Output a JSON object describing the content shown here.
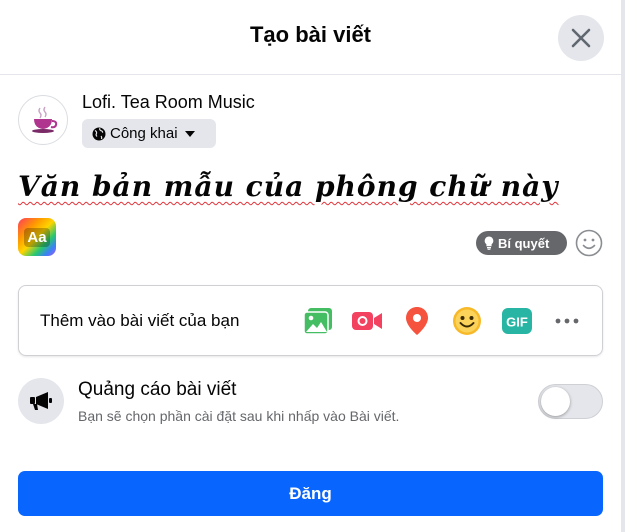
{
  "dialog": {
    "title": "Tạo bài viết",
    "close_icon": "close-icon"
  },
  "user": {
    "name": "Lofi. Tea Room Music",
    "avatar_icon": "teacup-avatar",
    "privacy": {
      "label": "Công khai",
      "icon": "globe-icon",
      "caret_icon": "caret-down-icon"
    }
  },
  "composer": {
    "text": "Văn bản mẫu của phông chữ này",
    "background_picker_label": "Aa",
    "tips_label": "Bí quyết",
    "tips_icon": "lightbulb-icon",
    "emoji_icon": "smiley-icon"
  },
  "add_to_post": {
    "label": "Thêm vào bài viết của bạn",
    "items": [
      {
        "name": "photo-video",
        "icon": "photo-icon",
        "color": "#45bd62"
      },
      {
        "name": "live-video",
        "icon": "video-camera-icon",
        "color": "#f3425f"
      },
      {
        "name": "check-in",
        "icon": "location-pin-icon",
        "color": "#f5533d"
      },
      {
        "name": "feeling-activity",
        "icon": "smiley-icon",
        "color": "#f7b928"
      },
      {
        "name": "gif",
        "icon": "gif-icon",
        "label": "GIF",
        "color": "#28b5a3"
      },
      {
        "name": "more",
        "icon": "more-dots-icon",
        "color": "#65676b"
      }
    ]
  },
  "boost": {
    "title": "Quảng cáo bài viết",
    "description": "Bạn sẽ chọn phần cài đặt sau khi nhấp vào Bài viết.",
    "icon": "megaphone-icon",
    "enabled": false
  },
  "submit": {
    "label": "Đăng",
    "color": "#0866ff"
  }
}
